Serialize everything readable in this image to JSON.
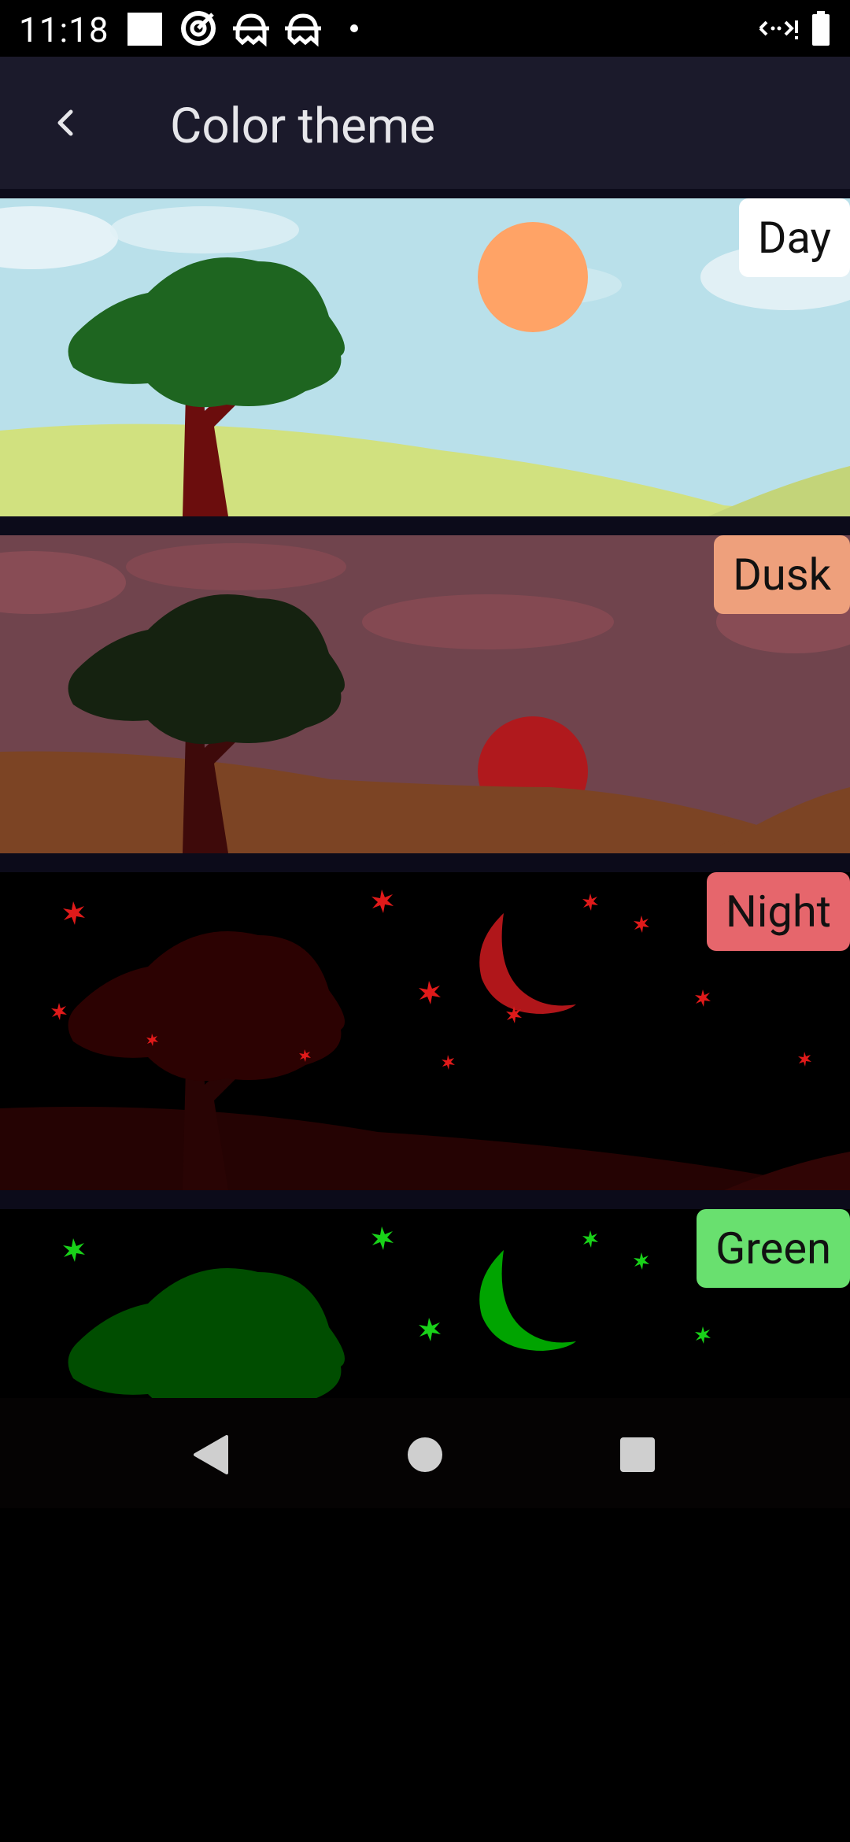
{
  "status_bar": {
    "time": "11:18",
    "icons": [
      "square-icon",
      "target-icon",
      "ghost-icon",
      "ghost-icon",
      "dot-icon",
      "data-arrows-icon",
      "battery-icon"
    ]
  },
  "app_bar": {
    "back_icon": "chevron-left-icon",
    "title": "Color theme"
  },
  "themes": [
    {
      "label": "Day",
      "badge_color": "#ffffff"
    },
    {
      "label": "Dusk",
      "badge_color": "#eea07c"
    },
    {
      "label": "Night",
      "badge_color": "#e6666c"
    },
    {
      "label": "Green",
      "badge_color": "#69e06f"
    }
  ],
  "nav_bar": {
    "back": "triangle-back-icon",
    "home": "circle-home-icon",
    "recents": "square-recents-icon"
  }
}
